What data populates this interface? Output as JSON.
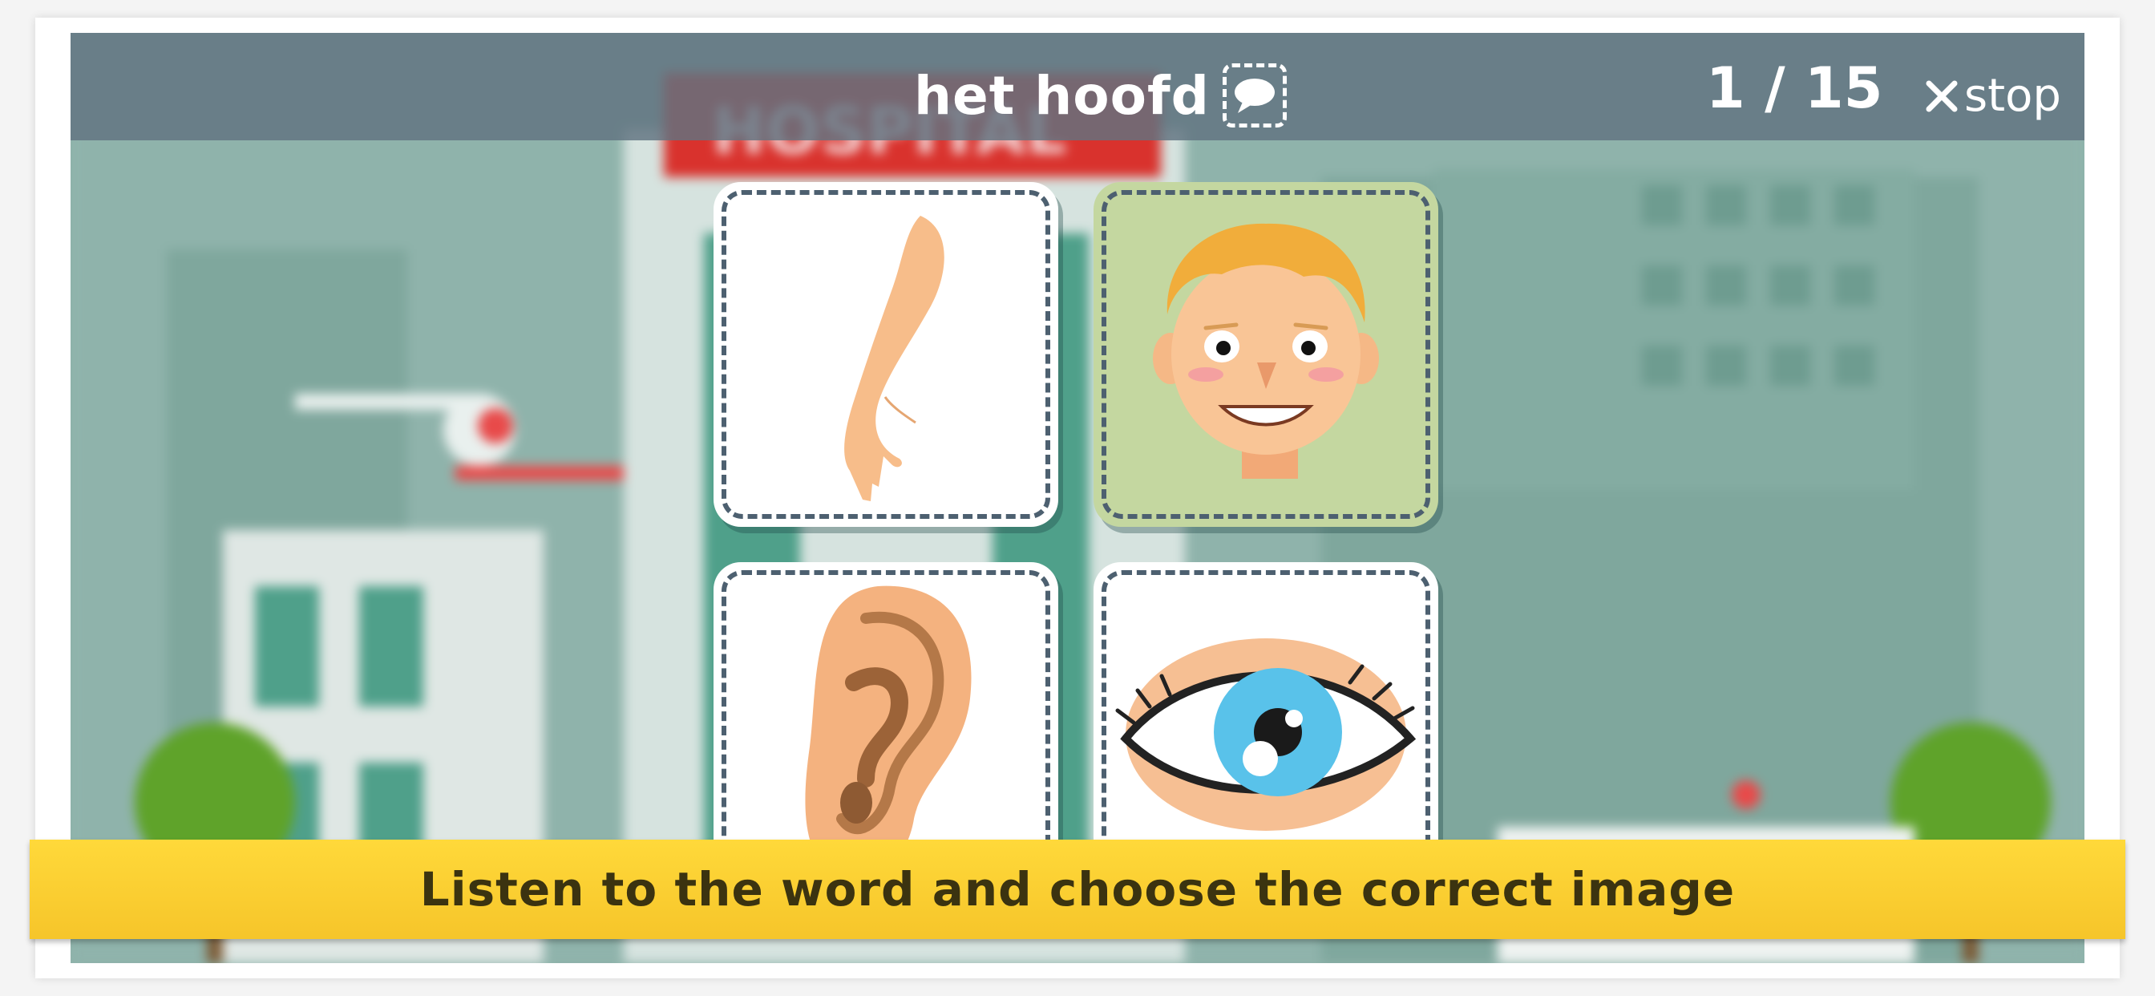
{
  "header": {
    "word": "het hoofd",
    "progress": "1 / 15",
    "stop_label": "stop",
    "speak_icon": "speech-bubble-icon",
    "close_icon": "close-icon"
  },
  "scene": {
    "sign_text": "HOSPITAL"
  },
  "cards": [
    {
      "image": "arm",
      "highlighted": false
    },
    {
      "image": "head",
      "highlighted": true
    },
    {
      "image": "ear",
      "highlighted": false
    },
    {
      "image": "eye",
      "highlighted": false
    }
  ],
  "instruction": "Listen to the word and choose the correct image",
  "colors": {
    "banner": "#fcd234",
    "card_highlight": "#c4d7a0",
    "topbar": "#607380",
    "background": "#8fb3ab"
  }
}
